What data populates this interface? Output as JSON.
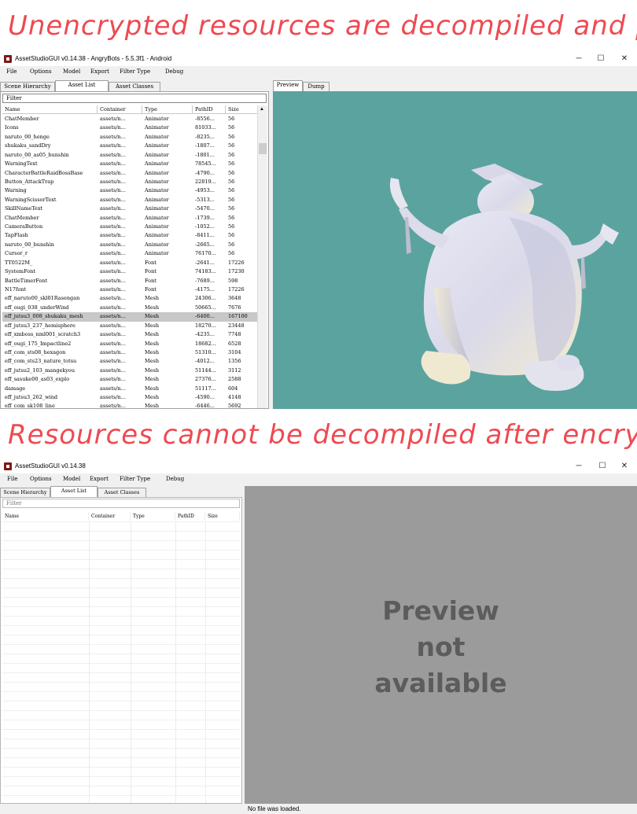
{
  "captions": {
    "top": "Unencrypted resources are decompiled and parsed",
    "bottom": "Resources cannot be decompiled after encryption"
  },
  "window1": {
    "title": "AssetStudioGUI v0.14.38 - AngryBots - 5.5.3f1 - Android",
    "controls": {
      "minimize": "─",
      "maximize": "☐",
      "close": "✕"
    },
    "menu": [
      "File",
      "Options",
      "Model",
      "Export",
      "Filter Type",
      "Debug"
    ],
    "tabs": [
      "Scene Hierarchy",
      "Asset List",
      "Asset Classes"
    ],
    "active_tab": "Asset List",
    "right_tabs": [
      "Preview",
      "Dump"
    ],
    "filter_placeholder": "Filter",
    "columns": [
      "Name",
      "Container",
      "Type",
      "PathID",
      "Size"
    ],
    "rows": [
      [
        "ChatMember",
        "assets/n...",
        "Animator",
        "-8556...",
        "56"
      ],
      [
        "Icons",
        "assets/n...",
        "Animator",
        "81033...",
        "56"
      ],
      [
        "naruto_00_henge",
        "assets/n...",
        "Animator",
        "-8235...",
        "56"
      ],
      [
        "shukaku_sandDry",
        "assets/n...",
        "Animator",
        "-1807...",
        "56"
      ],
      [
        "naruto_00_as05_bunshin",
        "assets/n...",
        "Animator",
        "-1801...",
        "56"
      ],
      [
        "WarningText",
        "assets/n...",
        "Animator",
        "78545...",
        "56"
      ],
      [
        "CharacterBattleRaidBossBase",
        "assets/n...",
        "Animator",
        "-4790...",
        "56"
      ],
      [
        "Button_AttackTrap",
        "assets/n...",
        "Animator",
        "22819...",
        "56"
      ],
      [
        "Warning",
        "assets/n...",
        "Animator",
        "-4953...",
        "56"
      ],
      [
        "WarningScissorText",
        "assets/n...",
        "Animator",
        "-5313...",
        "56"
      ],
      [
        "SkillNameText",
        "assets/n...",
        "Animator",
        "-5470...",
        "56"
      ],
      [
        "ChatMember",
        "assets/n...",
        "Animator",
        "-1739...",
        "56"
      ],
      [
        "CameraButton",
        "assets/n...",
        "Animator",
        "-1052...",
        "56"
      ],
      [
        "TapFlash",
        "assets/n...",
        "Animator",
        "-8411...",
        "56"
      ],
      [
        "naruto_00_bunshin",
        "assets/n...",
        "Animator",
        "-2665...",
        "56"
      ],
      [
        "Cursor_r",
        "assets/n...",
        "Animator",
        "76170...",
        "56"
      ],
      [
        "TT0522M_",
        "assets/n...",
        "Font",
        "-2641...",
        "17226"
      ],
      [
        "SystemFont",
        "assets/n...",
        "Font",
        "74183...",
        "17230"
      ],
      [
        "BattleTimerFont",
        "assets/n...",
        "Font",
        "-7689...",
        "598"
      ],
      [
        "N17font",
        "assets/n...",
        "Font",
        "-4175...",
        "17226"
      ],
      [
        "eff_naruto00_skl01Rasengan",
        "assets/n...",
        "Mesh",
        "24306...",
        "3648"
      ],
      [
        "eff_ougi_038_underWind",
        "assets/n...",
        "Mesh",
        "50665...",
        "7676"
      ],
      [
        "eff_jutsu3_008_shukaku_mesh",
        "assets/n...",
        "Mesh",
        "-6400...",
        "167100"
      ],
      [
        "eff_jutsu3_237_hemisphere",
        "assets/n...",
        "Mesh",
        "18270...",
        "23448"
      ],
      [
        "eff_xmboss_nml001_scratch3",
        "assets/n...",
        "Mesh",
        "-4235...",
        "7748"
      ],
      [
        "eff_ougi_175_Impactline2",
        "assets/n...",
        "Mesh",
        "18682...",
        "6528"
      ],
      [
        "eff_com_sts08_hexagon",
        "assets/n...",
        "Mesh",
        "51310...",
        "3104"
      ],
      [
        "eff_com_sts23_nature_totsu",
        "assets/n...",
        "Mesh",
        "-4012...",
        "1356"
      ],
      [
        "eff_jutsu2_103_mangekyou",
        "assets/n...",
        "Mesh",
        "51144...",
        "3112"
      ],
      [
        "eff_sasuke00_as03_explo",
        "assets/n...",
        "Mesh",
        "27376...",
        "2588"
      ],
      [
        "damage",
        "assets/n...",
        "Mesh",
        "51117...",
        "604"
      ],
      [
        "eff_jutsu3_262_wind",
        "assets/n...",
        "Mesh",
        "-4590...",
        "4148"
      ],
      [
        "eff_com_sk108_line",
        "assets/n...",
        "Mesh",
        "-6446...",
        "5692"
      ]
    ],
    "selected_row": 22,
    "preview_bg": "#5ba39f"
  },
  "window2": {
    "title": "AssetStudioGUI v0.14.38",
    "controls": {
      "minimize": "─",
      "maximize": "☐",
      "close": "✕"
    },
    "menu": [
      "File",
      "Options",
      "Model",
      "Export",
      "Filter Type",
      "Debug"
    ],
    "tabs": [
      "Scene Hierarchy",
      "Asset List",
      "Asset Classes"
    ],
    "active_tab": "Asset List",
    "filter_placeholder": "Filter",
    "columns": [
      "Name",
      "Container",
      "Type",
      "PathID",
      "Size"
    ],
    "preview_line1": "Preview",
    "preview_line2": "not",
    "preview_line3": "available",
    "status": "No file was loaded.",
    "preview_bg": "#9b9b9b"
  },
  "colors": {
    "caption": "#ee4a52",
    "selection": "#c8c8c8"
  }
}
